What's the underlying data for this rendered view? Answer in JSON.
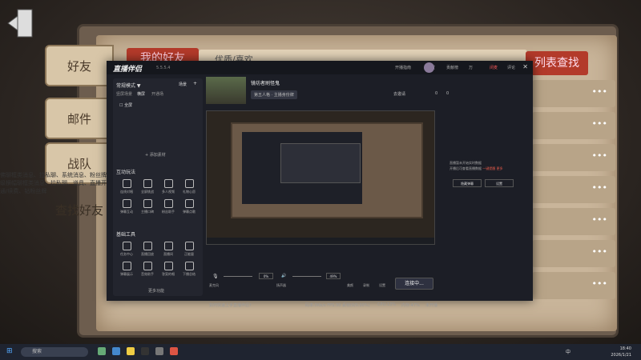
{
  "game": {
    "tabs": [
      "好友",
      "邮件",
      "战队",
      "查找好友"
    ],
    "my_friends": "我的好友",
    "header_partial": "优质/喜欢",
    "list_find": "列表查找",
    "row_ellipsis": "•••",
    "left_text": "佛聊框类消息、拉私聊、系统消息、粉丝牌升级横幅聊框类消息、拉私聊、道具、直播开通/续费、钻粉丝牌"
  },
  "app": {
    "name": "直播伴侣",
    "version": "5.5.5.4",
    "titlebar": {
      "start_guide": "开播指南",
      "settings": "设置",
      "contribution": "贡献榜",
      "wan": "万",
      "mute": "闭麦",
      "jinghua": "评论"
    },
    "sidebar": {
      "mode": "常规模式 ▼",
      "scene": "场景",
      "add": "+",
      "scene_tabs": [
        "竖屏场景",
        "横屏",
        "开通场"
      ],
      "scene_item": "全屏",
      "add_material": "+ 添加素材",
      "interaction_title": "互动玩法",
      "interaction": [
        "连线对唱",
        "全屏挑战",
        "多人视频",
        "礼物心愿",
        "弹幕互动",
        "主播口碑",
        "粉丝助手",
        "弹幕点歌"
      ],
      "tools_title": "基础工具",
      "tools": [
        "任务中心",
        "直播回放",
        "直播间",
        "正能量",
        "弹幕展示",
        "音效助手",
        "答案的唱",
        "下播总结"
      ],
      "more": "更多功能"
    },
    "stream": {
      "title": "镜坊者刷怪鬼",
      "tag": "第五人格 · 主播身份牌",
      "stat_fans": "0",
      "stat_likes": "0",
      "invite": "去邀请"
    },
    "right_panel": {
      "line1": "直播暂未开始实时数据",
      "line2": "开播后可查看直播数据",
      "link": "一键提醒",
      "more": "更多",
      "btn_hide": "隐藏弹幕",
      "btn_settings": "设置"
    },
    "controls": {
      "mic": "麦克风",
      "mic_pct": "0%",
      "speaker": "扬声器",
      "spk_pct": "49%",
      "beauty": "美颜",
      "record": "录制",
      "settings": "设置",
      "connect": "连接中..."
    },
    "status": {
      "hint": "如何快速上手直播伴侣?",
      "fps": "码率:0Kb/s  FPS:30  丢帧(0/0.00%)",
      "cpu": "CPU:13%",
      "mem": "内存:47%",
      "net": "未开播"
    }
  },
  "taskbar": {
    "search": "搜索",
    "time": "18:40",
    "date": "2026/1/21",
    "lang": "中"
  },
  "colors": {
    "accent_red": "#b33a2a",
    "app_bg": "#1c1e26",
    "link": "#e55a4a"
  }
}
